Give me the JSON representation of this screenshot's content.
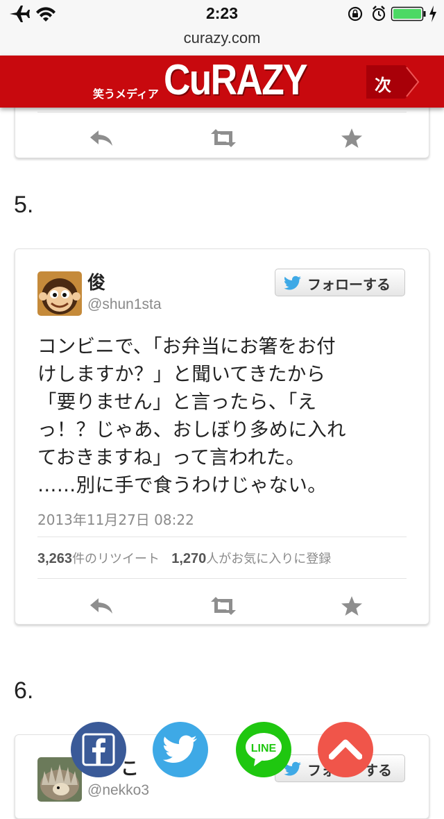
{
  "status_bar": {
    "time": "2:23",
    "icons": [
      "airplane-icon",
      "wifi-icon",
      "rotation-lock-icon",
      "alarm-icon",
      "battery-icon",
      "charging-icon"
    ]
  },
  "browser": {
    "url": "curazy.com"
  },
  "site": {
    "tagline": "笑うメディア",
    "logo": "CuRAZY",
    "next_label": "次",
    "brand_color": "#c8090e"
  },
  "sections": [
    {
      "number": "5."
    },
    {
      "number": "6."
    }
  ],
  "tweets": [
    {
      "name": "俊",
      "handle": "@shun1sta",
      "follow_label": "フォローする",
      "text_lines": [
        "コンビニで、「お弁当にお箸をお付",
        "けしますか？」と聞いてきたから",
        "「要りません」と言ったら、「え",
        "っ！？じゃあ、おしぼり多めに入れ",
        "ておきますね」って言われた。",
        "……別に手で食うわけじゃない。"
      ],
      "date": "2013年11月27日 08:22",
      "retweets": "3,263",
      "retweets_suffix": "件のリツイート",
      "favorites": "1,270",
      "favorites_suffix": "人がお気に入りに登録"
    },
    {
      "name_partial": "こ",
      "handle_partial": "@nekko3",
      "follow_label_partial": "フォ",
      "follow_label_tail": "する"
    }
  ],
  "share_bar": {
    "facebook": {
      "icon": "facebook-icon",
      "color": "#3a5a98"
    },
    "twitter": {
      "icon": "twitter-bird-icon",
      "color": "#3ea9e6"
    },
    "line": {
      "icon": "line-icon",
      "label": "LINE",
      "color": "#1fc710"
    },
    "scroll_top": {
      "icon": "chevron-up-icon",
      "color": "#f0554a"
    }
  }
}
